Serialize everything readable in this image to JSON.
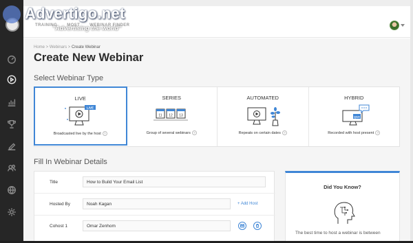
{
  "watermark": {
    "brand": "Advertigo.net",
    "tagline": "\"Advertising  the world\""
  },
  "header": {
    "nav": [
      "TRAINING",
      "MOST",
      "WEBINAR FINDER"
    ]
  },
  "breadcrumb": {
    "home": "Home",
    "sep1": " > ",
    "webinars": "Webinars",
    "sep2": " > ",
    "current": "Create Webinar"
  },
  "page_title": "Create New Webinar",
  "select_type": {
    "heading": "Select Webinar Type",
    "cards": [
      {
        "label": "LIVE",
        "desc": "Broadcasted live by the host",
        "badge": "LIVE",
        "selected": true
      },
      {
        "label": "SERIES",
        "desc": "Group of several webinars",
        "days": [
          "11",
          "12",
          "13"
        ]
      },
      {
        "label": "AUTOMATED",
        "desc": "Repeats on certain dates"
      },
      {
        "label": "HYBRID",
        "desc": "Recorded with host present",
        "badge": "Q&A"
      }
    ],
    "help": "?"
  },
  "details": {
    "heading": "Fill In Webinar Details",
    "title_label": "Title",
    "title_value": "How to Build Your Email List",
    "host_label": "Hosted By",
    "host_value": "Noah Kagan",
    "add_host": "+ Add Host",
    "cohost_label": "Cohost 1",
    "cohost_value": "Omar Zenhom"
  },
  "tip": {
    "title": "Did You Know?",
    "text": "The best time to host a webinar is between"
  },
  "colors": {
    "accent": "#3f86d6",
    "sidebar": "#262626"
  }
}
